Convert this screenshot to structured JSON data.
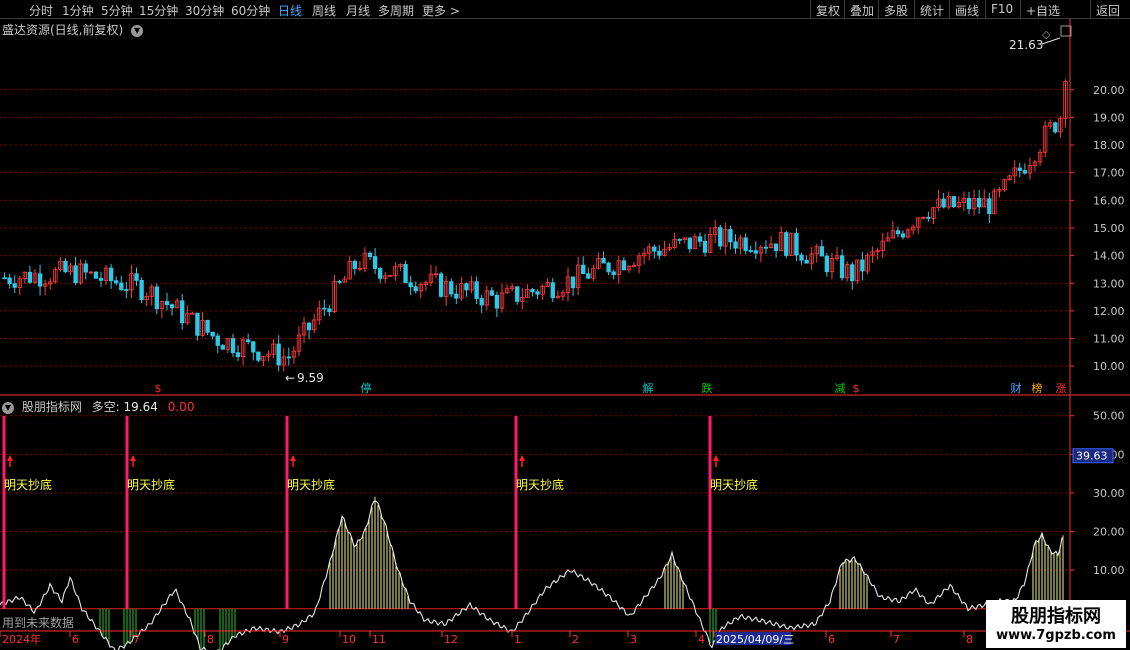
{
  "toolbar": {
    "periods": [
      {
        "label": "分时",
        "active": false
      },
      {
        "label": "1分钟",
        "active": false
      },
      {
        "label": "5分钟",
        "active": false
      },
      {
        "label": "15分钟",
        "active": false
      },
      {
        "label": "30分钟",
        "active": false
      },
      {
        "label": "60分钟",
        "active": false
      },
      {
        "label": "日线",
        "active": true
      },
      {
        "label": "周线",
        "active": false
      },
      {
        "label": "月线",
        "active": false
      },
      {
        "label": "多周期",
        "active": false
      },
      {
        "label": "更多 >",
        "active": false
      }
    ],
    "right_buttons": [
      "复权",
      "叠加",
      "多股",
      "统计",
      "画线",
      "F10",
      "+自选",
      "返回"
    ]
  },
  "main_chart": {
    "title": "盛达资源(日线,前复权)",
    "price_axis": [
      "20.00",
      "19.00",
      "18.00",
      "17.00",
      "16.00",
      "15.00",
      "14.00",
      "13.00",
      "12.00",
      "11.00",
      "10.00"
    ],
    "high_label": "21.63",
    "low_label": "9.59",
    "event_marks": [
      {
        "text": "$",
        "color": "#ff3030"
      },
      {
        "text": "停",
        "color": "#00c8c8"
      },
      {
        "text": "解",
        "color": "#00c8c8"
      },
      {
        "text": "跌",
        "color": "#00d000"
      },
      {
        "text": "减",
        "color": "#00d000"
      },
      {
        "text": "$",
        "color": "#ff3030"
      },
      {
        "text": "财",
        "color": "#4aa8ff"
      },
      {
        "text": "榜",
        "color": "#ffb000"
      },
      {
        "text": "涨",
        "color": "#ff3030"
      }
    ]
  },
  "indicator": {
    "name": "股朋指标网",
    "label": "多空:",
    "value1": "19.64",
    "value2": "0.00",
    "axis": [
      "50.00",
      "40.00",
      "30.00",
      "20.00",
      "10.00",
      "0.00"
    ],
    "current_value": "39.63",
    "signal_text": "明天抄底",
    "future_label": "用到未来数据"
  },
  "date_axis": {
    "labels": [
      "2024年",
      "6",
      "7",
      "8",
      "9",
      "10",
      "11",
      "12",
      "1",
      "2",
      "3",
      "4",
      "2025/04/09/三",
      "6",
      "7",
      "8"
    ]
  },
  "watermark": {
    "line1": "股朋指标网",
    "line2": "www.7gpzb.com"
  },
  "colors": {
    "up": "#ff3c3c",
    "down": "#2ec8e6",
    "grid": "#8b0000",
    "line": "#e8e8e8",
    "bar_positive": "#f0f080",
    "bar_negative": "#30c030",
    "signal": "#ff1a6e",
    "signal_text": "#ffff40",
    "active_period": "#4aa8ff"
  },
  "chart_data": {
    "type": "candlestick",
    "title": "盛达资源(日线,前复权)",
    "x": [
      "2024-05",
      "2024-06",
      "2024-07",
      "2024-08",
      "2024-09",
      "2024-10",
      "2024-11",
      "2024-12",
      "2025-01",
      "2025-02",
      "2025-03",
      "2025-04",
      "2025-05",
      "2025-06",
      "2025-07",
      "2025-08"
    ],
    "close": [
      13.2,
      13.4,
      12.8,
      11.0,
      10.3,
      13.8,
      13.0,
      12.4,
      13.1,
      14.1,
      14.6,
      14.5,
      13.3,
      15.7,
      15.9,
      19.3
    ],
    "ylim": [
      9.5,
      21.8
    ],
    "high": 21.63,
    "low": 9.59,
    "indicator": {
      "name": "多空",
      "ylim": [
        -5,
        52
      ],
      "signal_label": "明天抄底",
      "signal_count": 5
    }
  }
}
